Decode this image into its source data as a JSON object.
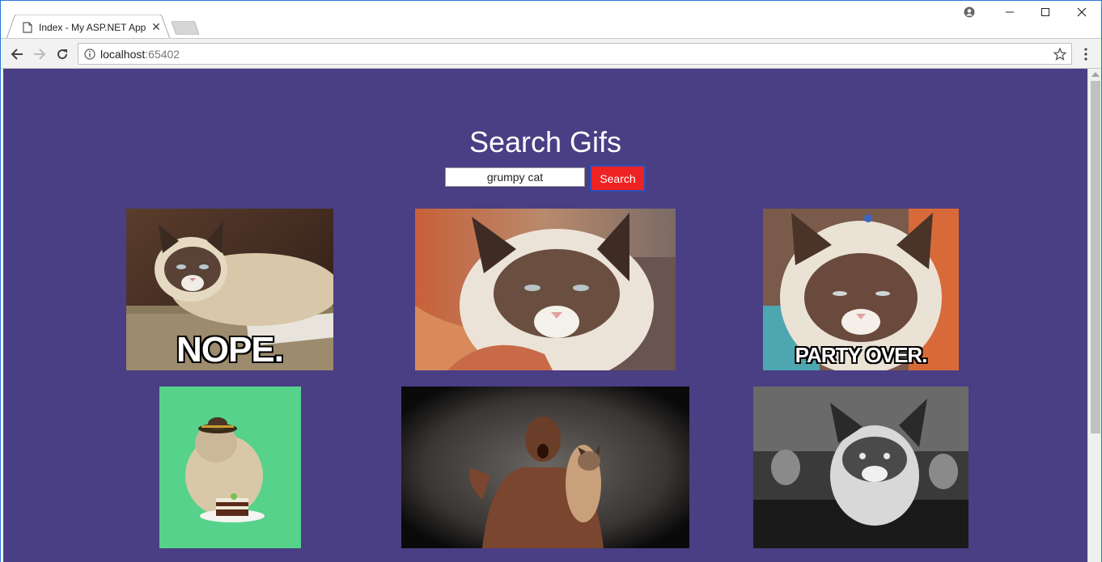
{
  "browser": {
    "tab_title": "Index - My ASP.NET App",
    "url_host": "localhost",
    "url_port": ":65402"
  },
  "page": {
    "heading": "Search Gifs",
    "search_value": "grumpy cat",
    "search_button": "Search",
    "background": "#4a3e84",
    "button_color": "#ee2222"
  },
  "gifs": [
    {
      "caption": "NOPE."
    },
    {
      "caption": ""
    },
    {
      "caption": "PARTY OVER."
    },
    {
      "caption": ""
    },
    {
      "caption": ""
    },
    {
      "caption": ""
    }
  ]
}
